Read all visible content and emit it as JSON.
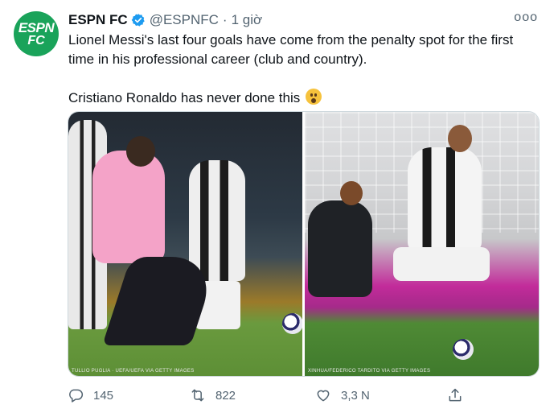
{
  "tweet": {
    "author_name": "ESPN FC",
    "handle": "@ESPNFC",
    "separator": "·",
    "time": "1 giờ",
    "more_label": "ooo",
    "avatar_text_1": "ESPN",
    "avatar_text_2": "FC",
    "text_1": "Lionel Messi's last four goals have come from the penalty spot for the first time in his professional career (club and country).",
    "text_2": "Cristiano Ronaldo has never done this",
    "media": {
      "left_credit": "TULLIO PUGLIA · UEFA/UEFA VIA GETTY IMAGES",
      "right_credit": "XINHUA/FEDERICO TARDITO VIA GETTY IMAGES"
    },
    "actions": {
      "reply_count": "145",
      "retweet_count": "822",
      "like_count": "3,3 N"
    }
  },
  "colors": {
    "avatar_bg": "#1aa35a",
    "verified": "#1d9bf0",
    "secondary_text": "#536471"
  },
  "icons": [
    "verified-badge-icon",
    "more-icon",
    "reply-icon",
    "retweet-icon",
    "like-icon",
    "share-icon",
    "face-with-open-mouth-emoji"
  ]
}
